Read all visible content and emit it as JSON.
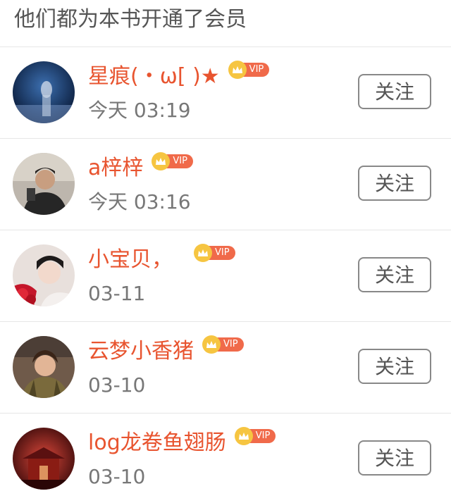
{
  "header": {
    "title": "他们都为本书开通了会员"
  },
  "members": [
    {
      "name": "星痕(・ω[ )★",
      "time": "今天 03:19",
      "vip_label": "VIP",
      "follow_label": "关注"
    },
    {
      "name": "a梓梓",
      "time": "今天 03:16",
      "vip_label": "VIP",
      "follow_label": "关注"
    },
    {
      "name": "小宝贝，",
      "time": "03-11",
      "vip_label": "VIP",
      "follow_label": "关注"
    },
    {
      "name": "云梦小香猪",
      "time": "03-10",
      "vip_label": "VIP",
      "follow_label": "关注"
    },
    {
      "name": "log龙卷鱼翅肠",
      "time": "03-10",
      "vip_label": "VIP",
      "follow_label": "关注"
    }
  ],
  "colors": {
    "name": "#e8542f",
    "vip_pill": "#f06a4a",
    "crown": "#f6c541",
    "button_border": "#888888"
  }
}
